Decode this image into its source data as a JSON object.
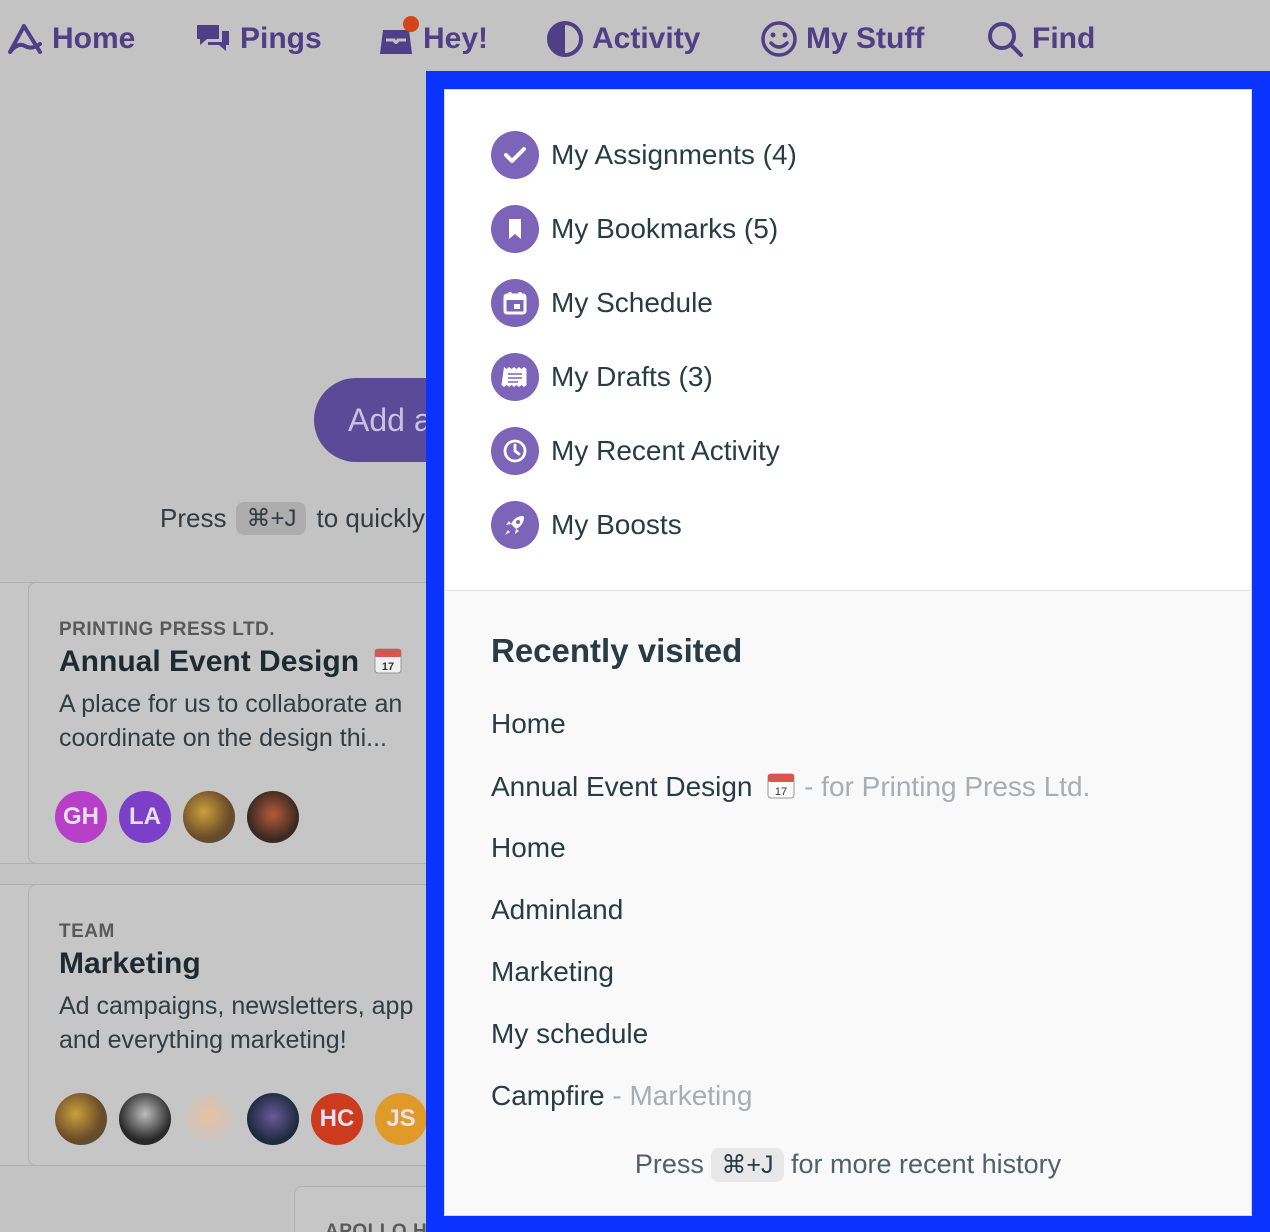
{
  "nav": {
    "items": [
      {
        "label": "Home",
        "icon": "basecamp-mountain-icon"
      },
      {
        "label": "Pings",
        "icon": "chat-bubbles-icon"
      },
      {
        "label": "Hey!",
        "icon": "inbox-tray-icon"
      },
      {
        "label": "Activity",
        "icon": "half-moon-icon"
      },
      {
        "label": "My Stuff",
        "icon": "smiley-face-icon"
      },
      {
        "label": "Find",
        "icon": "magnifier-icon"
      }
    ],
    "accent_color": "#4f3f87",
    "notification_dot_color": "#d4451a"
  },
  "background": {
    "add_button_label": "Add a",
    "hint_press": "Press",
    "hint_key": "⌘+J",
    "hint_rest": "to quickly",
    "cards": [
      {
        "account": "PRINTING PRESS LTD.",
        "title": "Annual Event Design",
        "desc_line1": "A place for us to collaborate an",
        "desc_line2": "coordinate on the design thi...",
        "avatars": [
          "GH",
          "LA",
          "",
          ""
        ]
      },
      {
        "account": "TEAM",
        "title": "Marketing",
        "desc_line1": "Ad campaigns, newsletters, app",
        "desc_line2": "and everything marketing!",
        "avatars": [
          "",
          "",
          "",
          "",
          "HC",
          "JS"
        ]
      }
    ],
    "partial_card_label": "APOLLO H"
  },
  "my_stuff": {
    "items": [
      {
        "label": "My Assignments (4)",
        "icon": "checkmark-icon"
      },
      {
        "label": "My Bookmarks (5)",
        "icon": "bookmark-icon"
      },
      {
        "label": "My Schedule",
        "icon": "calendar-icon"
      },
      {
        "label": "My Drafts (3)",
        "icon": "draft-document-icon"
      },
      {
        "label": "My Recent Activity",
        "icon": "clock-icon"
      },
      {
        "label": "My Boosts",
        "icon": "rocket-icon"
      }
    ],
    "icon_color": "#7c64b8"
  },
  "recently_visited": {
    "heading": "Recently visited",
    "items": [
      {
        "label": "Home",
        "sub": ""
      },
      {
        "label": "Annual Event Design",
        "sub": "- for Printing Press Ltd."
      },
      {
        "label": "Home",
        "sub": ""
      },
      {
        "label": "Adminland",
        "sub": ""
      },
      {
        "label": "Marketing",
        "sub": ""
      },
      {
        "label": "My schedule",
        "sub": ""
      },
      {
        "label": "Campfire",
        "sub": "- Marketing"
      }
    ],
    "hint_press": "Press",
    "hint_key": "⌘+J",
    "hint_rest": "for more recent history"
  },
  "highlight_color": "#0a33ff"
}
